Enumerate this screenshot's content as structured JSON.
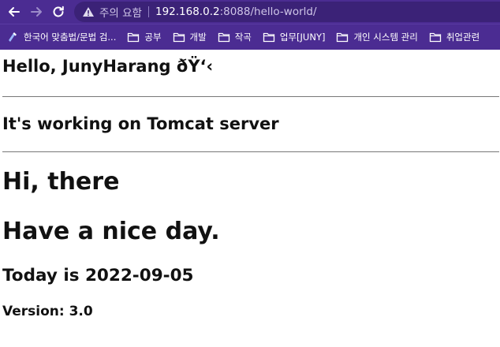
{
  "browser": {
    "security_label": "주의 요함",
    "url_host": "192.168.0.2",
    "url_rest": ":8088/hello-world/",
    "bookmarks": [
      {
        "label": "한국어 맞춤법/문법 검...",
        "icon": "app-icon"
      },
      {
        "label": "공부",
        "icon": "folder-icon"
      },
      {
        "label": "개발",
        "icon": "folder-icon"
      },
      {
        "label": "작곡",
        "icon": "folder-icon"
      },
      {
        "label": "업무[JUNY]",
        "icon": "folder-icon"
      },
      {
        "label": "개인 시스템 관리",
        "icon": "folder-icon"
      },
      {
        "label": "취업관련",
        "icon": "folder-icon"
      }
    ]
  },
  "page": {
    "greeting": "Hello, JunyHarang ðŸ‘‹",
    "server_line": "It's working on Tomcat server",
    "hi": "Hi, there",
    "wish": "Have a nice day.",
    "today": "Today is 2022-09-05",
    "version": "Version: 3.0"
  },
  "colors": {
    "toolbar_bg": "#4b2c92",
    "address_bg": "#3b2277"
  }
}
